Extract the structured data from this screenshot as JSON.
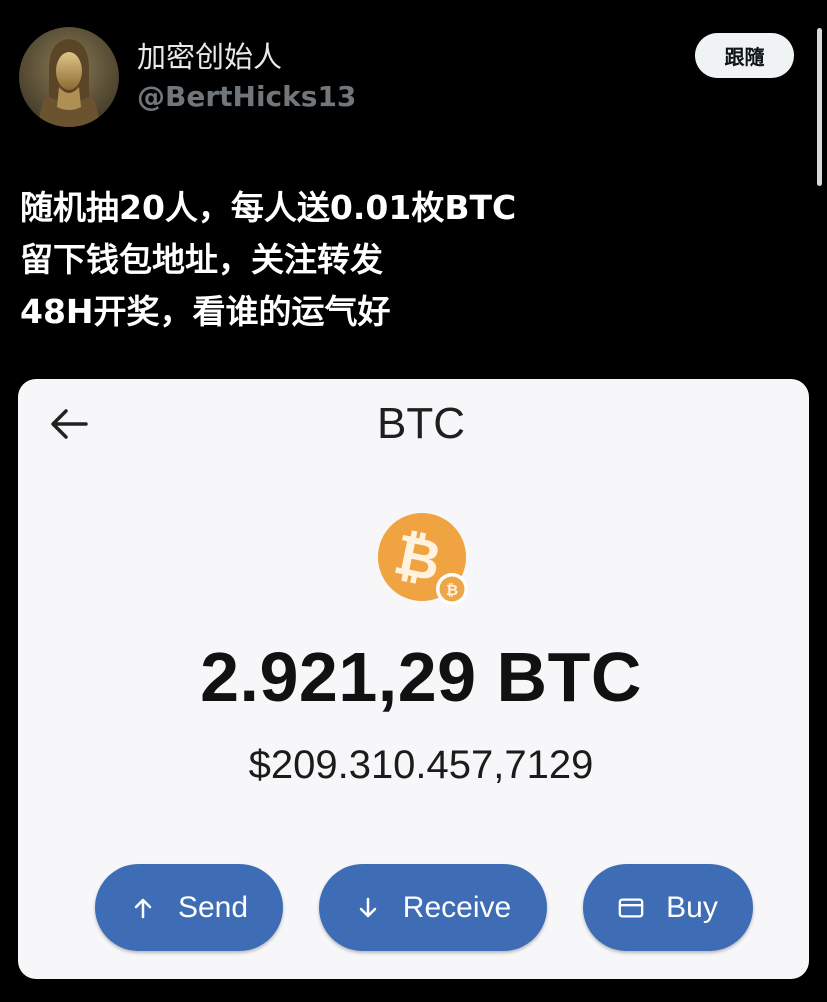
{
  "author": {
    "display_name": "加密创始人",
    "handle": "@BertHicks13",
    "follow_label": "跟隨"
  },
  "tweet": {
    "lines": [
      "随机抽20人，每人送0.01枚BTC",
      "留下钱包地址，关注转发",
      "48H开奖，看谁的运气好"
    ]
  },
  "wallet": {
    "title": "BTC",
    "balance": "2.921,29 BTC",
    "fiat_value": "$209.310.457,7129",
    "coin_icon": "bitcoin-logo",
    "accent_color": "#f0a03a",
    "actions": [
      {
        "label": "Send",
        "icon": "arrow-up-icon"
      },
      {
        "label": "Receive",
        "icon": "arrow-down-icon"
      },
      {
        "label": "Buy",
        "icon": "credit-card-icon"
      }
    ],
    "button_color": "#3e6db5"
  }
}
